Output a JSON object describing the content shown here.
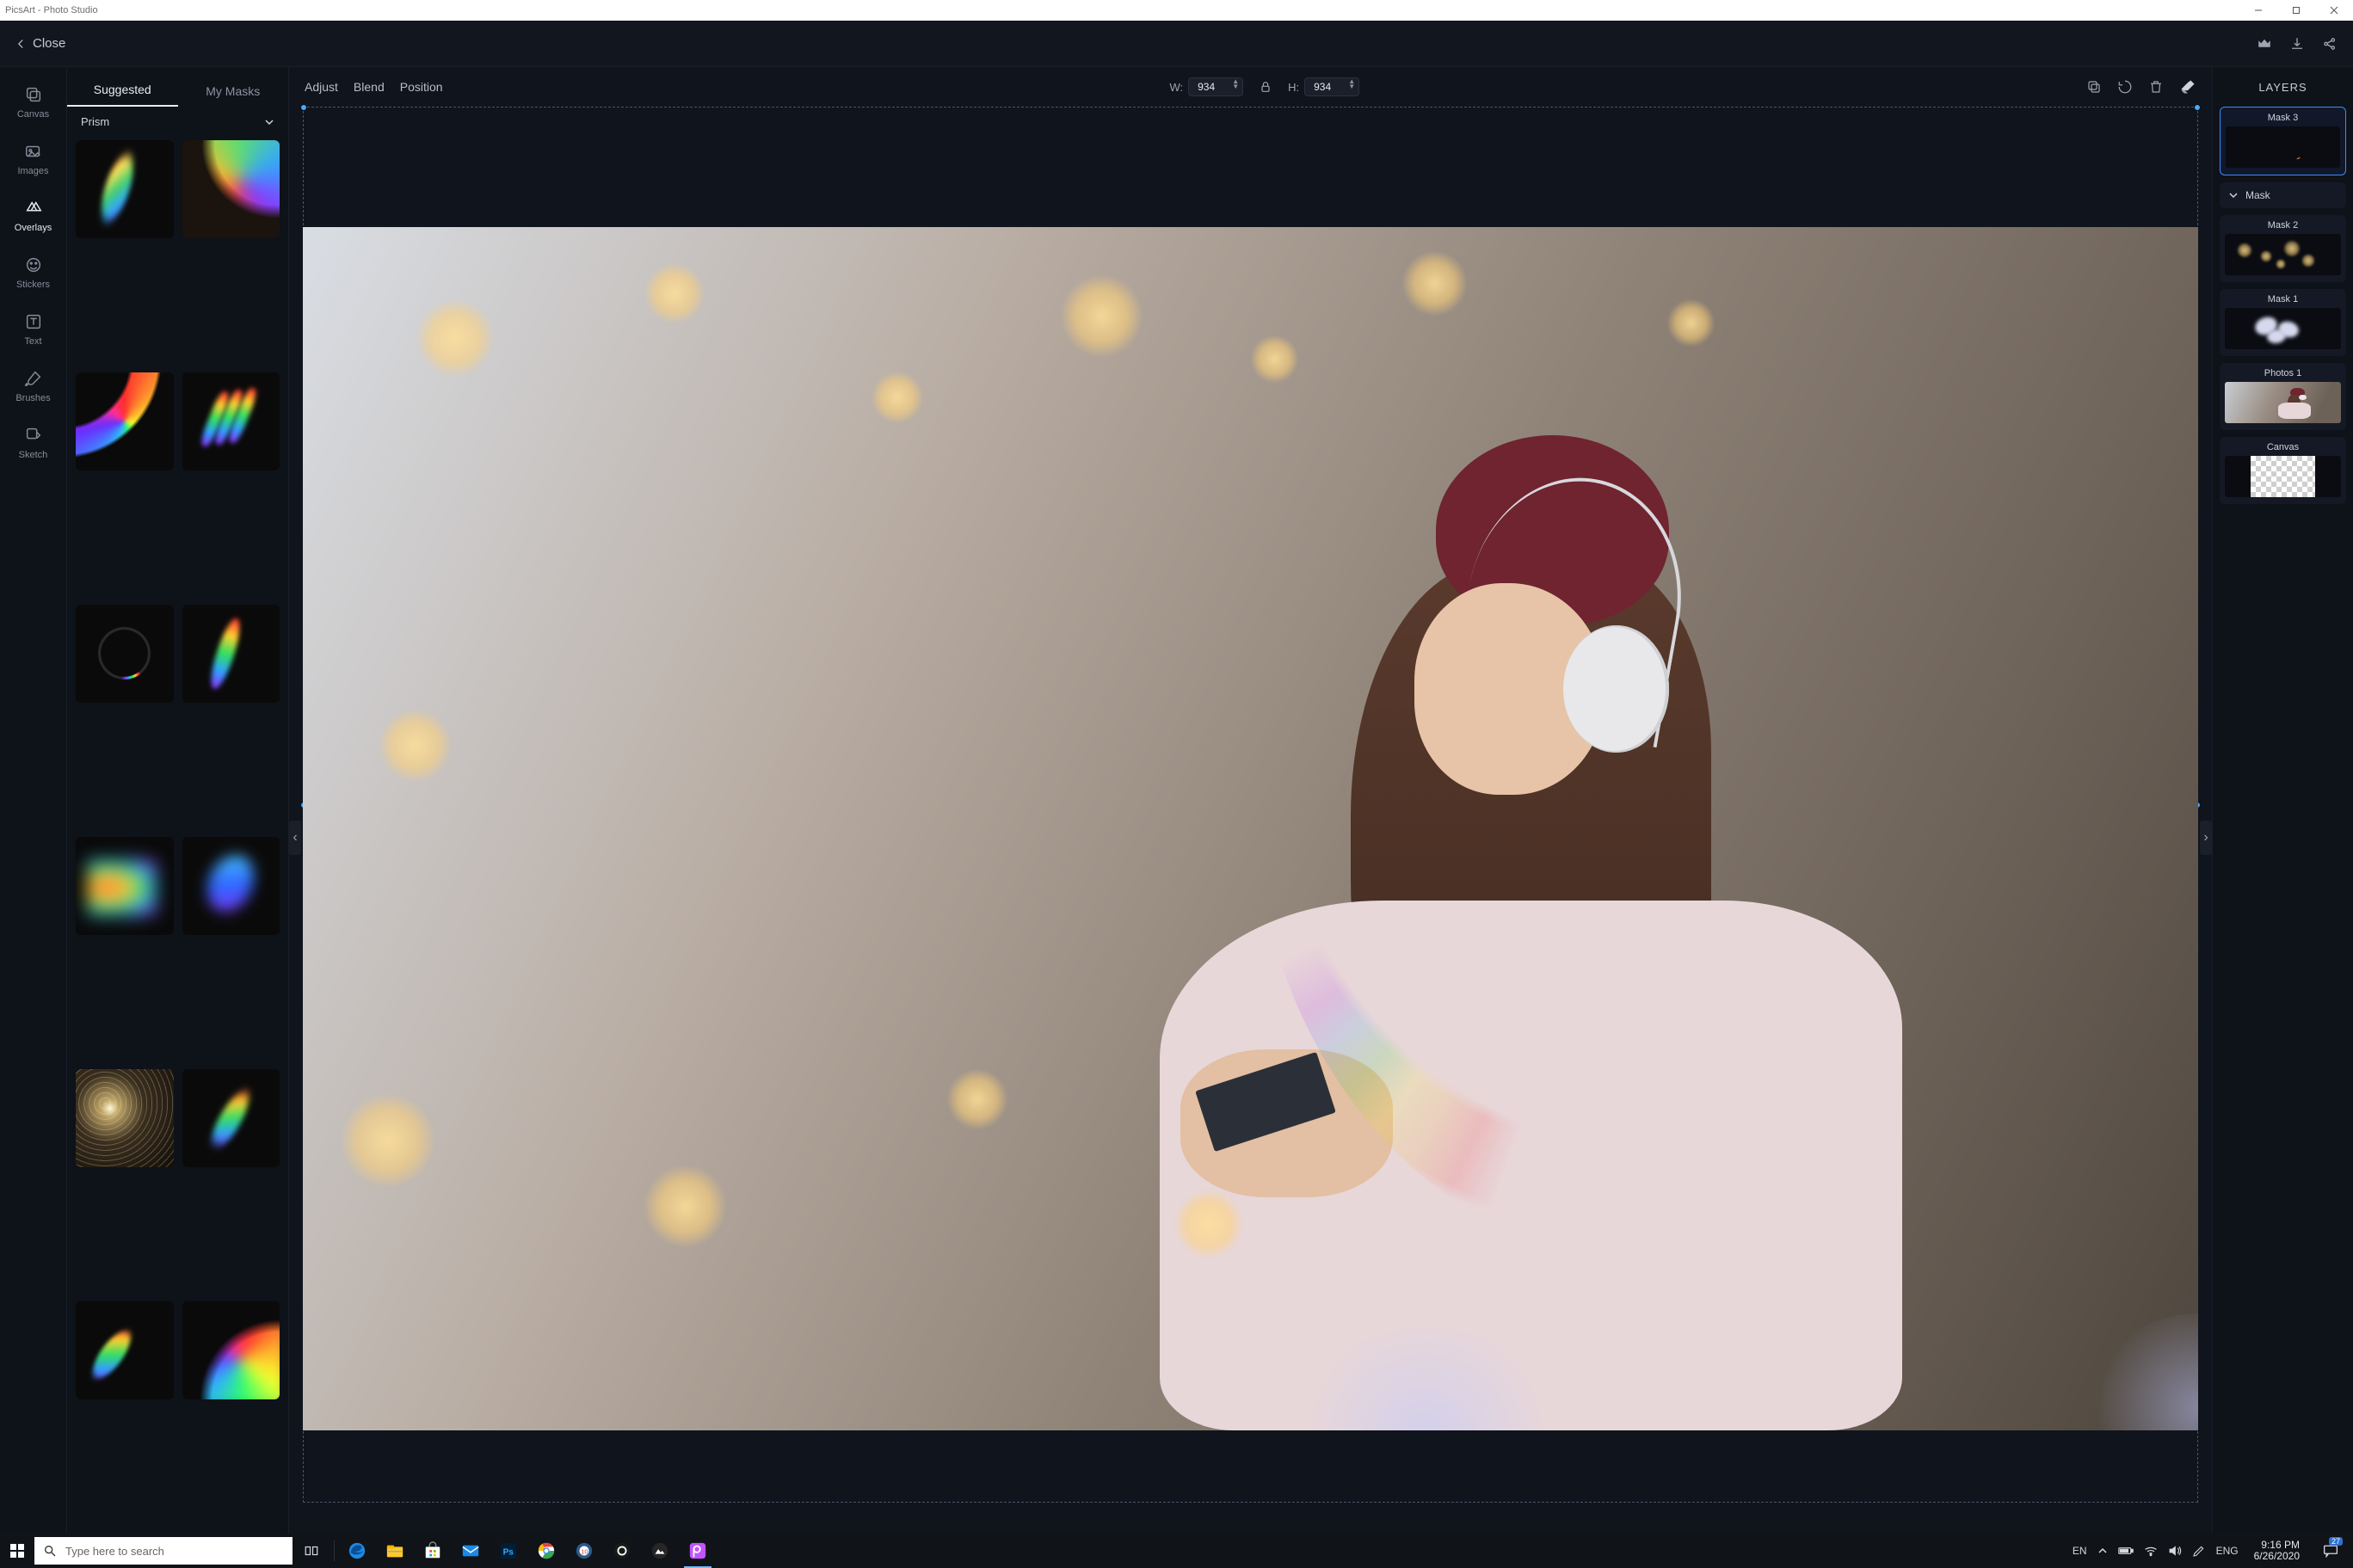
{
  "window": {
    "title": "PicsArt - Photo Studio"
  },
  "header": {
    "close_label": "Close"
  },
  "rail": {
    "items": [
      {
        "label": "Canvas"
      },
      {
        "label": "Images"
      },
      {
        "label": "Overlays"
      },
      {
        "label": "Stickers"
      },
      {
        "label": "Text"
      },
      {
        "label": "Brushes"
      },
      {
        "label": "Sketch"
      }
    ]
  },
  "panel": {
    "tabs": {
      "suggested": "Suggested",
      "mymasks": "My Masks"
    },
    "category": "Prism"
  },
  "controls": {
    "adjust": "Adjust",
    "blend": "Blend",
    "position": "Position",
    "w_label": "W:",
    "h_label": "H:",
    "width": "934",
    "height": "934"
  },
  "layers": {
    "title": "LAYERS",
    "mask_group": "Mask",
    "items": [
      {
        "label": "Mask 3"
      },
      {
        "label": "Mask 2"
      },
      {
        "label": "Mask 1"
      },
      {
        "label": "Photos 1"
      },
      {
        "label": "Canvas"
      }
    ]
  },
  "taskbar": {
    "search_placeholder": "Type here to search",
    "lang1": "EN",
    "lang2": "ENG",
    "time": "9:16 PM",
    "date": "6/26/2020",
    "notif_count": "27"
  }
}
